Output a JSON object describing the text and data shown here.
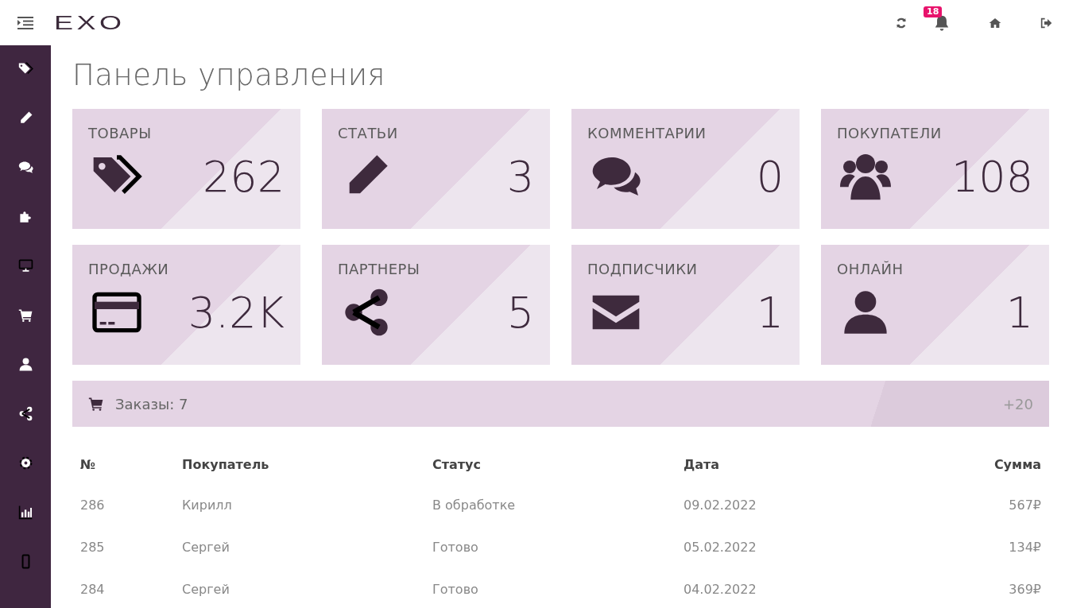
{
  "header": {
    "logo": "EXO",
    "notifications_badge": "18"
  },
  "page_title": "Панель управления",
  "stats": [
    {
      "label": "ТОВАРЫ",
      "value": "262"
    },
    {
      "label": "СТАТЬИ",
      "value": "3"
    },
    {
      "label": "КОММЕНТАРИИ",
      "value": "0"
    },
    {
      "label": "ПОКУПАТЕЛИ",
      "value": "108"
    },
    {
      "label": "ПРОДАЖИ",
      "value": "3.2K"
    },
    {
      "label": "ПАРТНЕРЫ",
      "value": "5"
    },
    {
      "label": "ПОДПИСЧИКИ",
      "value": "1"
    },
    {
      "label": "ОНЛАЙН",
      "value": "1"
    }
  ],
  "orders_bar": {
    "title": "Заказы: 7",
    "count": "+20"
  },
  "orders_table": {
    "columns": [
      "№",
      "Покупатель",
      "Статус",
      "Дата",
      "Сумма"
    ],
    "rows": [
      [
        "286",
        "Кирилл",
        "В обработке",
        "09.02.2022",
        "567₽"
      ],
      [
        "285",
        "Сергей",
        "Готово",
        "05.02.2022",
        "134₽"
      ],
      [
        "284",
        "Сергей",
        "Готово",
        "04.02.2022",
        "369₽"
      ]
    ]
  }
}
